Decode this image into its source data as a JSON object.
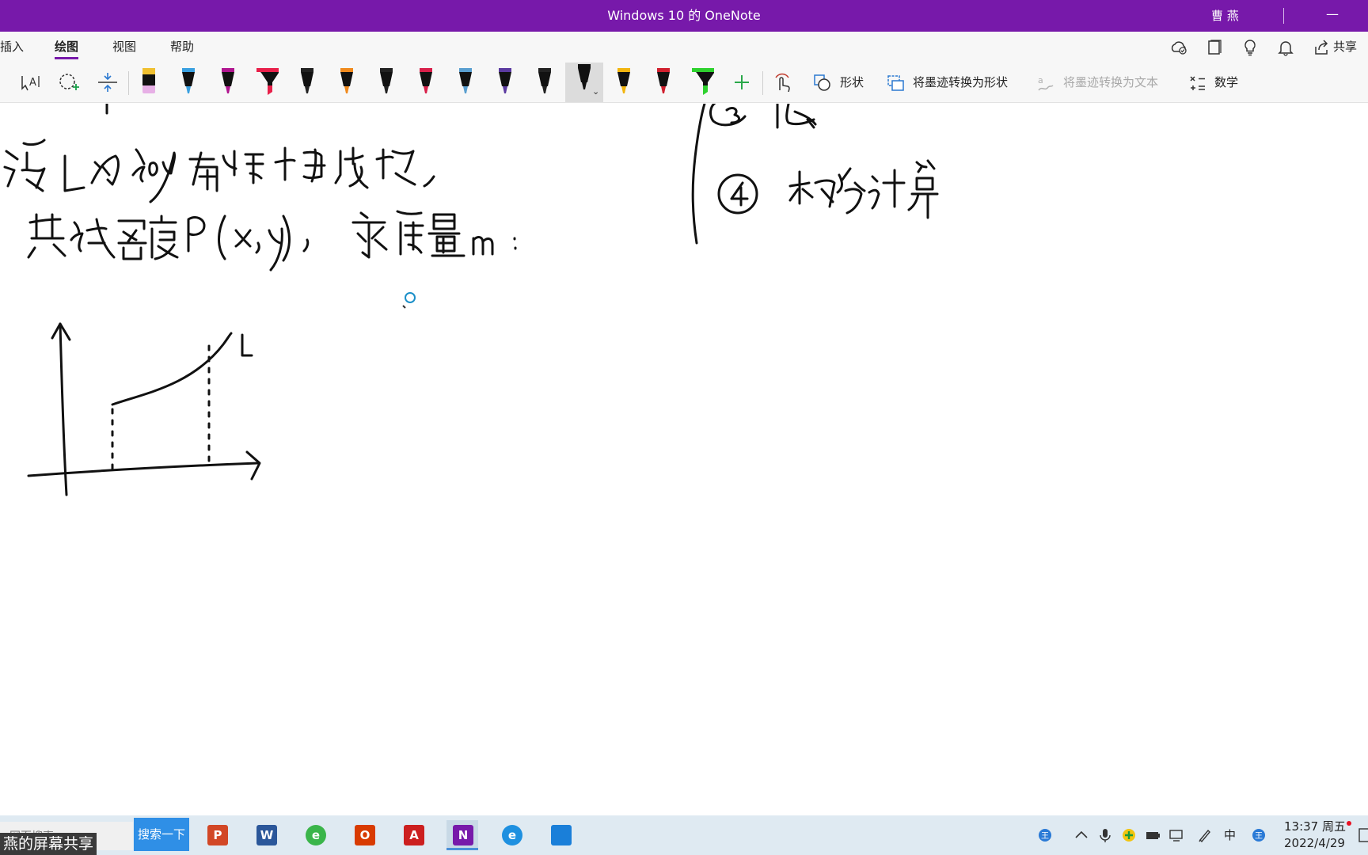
{
  "window": {
    "title": "Windows 10 的 OneNote",
    "user": "曹 燕",
    "minimize": "—"
  },
  "tabs": [
    {
      "label": "插入"
    },
    {
      "label": "绘图",
      "active": true
    },
    {
      "label": "视图"
    },
    {
      "label": "帮助"
    }
  ],
  "header": {
    "share_label": "共享"
  },
  "toolbar": {
    "shapes_label": "形状",
    "ink_to_shape_label": "将墨迹转换为形状",
    "ink_to_text_label": "将墨迹转换为文本",
    "math_label": "数学",
    "pens": [
      {
        "color": "#e7b0e6"
      },
      {
        "color": "#3aa0e0"
      },
      {
        "color": "#b0168f"
      },
      {
        "color": "#e8204a"
      },
      {
        "color": "#222222"
      },
      {
        "color": "#f08a1e"
      },
      {
        "color": "#222222"
      },
      {
        "color": "#d8204a"
      },
      {
        "color": "#5a9fd0"
      },
      {
        "color": "#5b3aa0"
      },
      {
        "color": "#222222"
      },
      {
        "color": "#111111"
      },
      {
        "color": "#f2b50f"
      },
      {
        "color": "#d0202e"
      },
      {
        "color": "#2ed12e"
      }
    ]
  },
  "note": {
    "ink_label_L": "L"
  },
  "taskbar": {
    "search_placeholder": "网页搜索",
    "search_button": "搜索一下",
    "screen_share_banner": "燕的屏幕共享",
    "apps": [
      {
        "name": "powerpoint",
        "letter": "P",
        "color": "#d24726"
      },
      {
        "name": "word",
        "letter": "W",
        "color": "#2b579a"
      },
      {
        "name": "ie-green",
        "letter": "e",
        "color": "#3ab54a"
      },
      {
        "name": "office",
        "letter": "O",
        "color": "#d83b01"
      },
      {
        "name": "acrobat",
        "letter": "A",
        "color": "#cc1f1f"
      },
      {
        "name": "onenote",
        "letter": "N",
        "color": "#7719aa"
      },
      {
        "name": "ie",
        "letter": "e",
        "color": "#1e90e0"
      },
      {
        "name": "photos",
        "letter": "",
        "color": "#1a7fd9"
      }
    ],
    "ime_label": "中",
    "clock_time": "13:37 周五",
    "clock_date": "2022/4/29"
  }
}
